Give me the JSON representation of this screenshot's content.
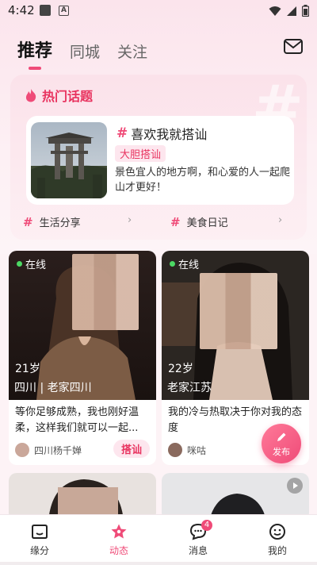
{
  "status_bar": {
    "time": "4:42",
    "icon_a": "A"
  },
  "tabs": [
    {
      "label": "推荐",
      "active": true
    },
    {
      "label": "同城",
      "active": false
    },
    {
      "label": "关注",
      "active": false
    }
  ],
  "hot_topics": {
    "title": "热门话题",
    "featured": {
      "hash": "#",
      "title": "喜欢我就搭讪",
      "tag": "大胆搭讪",
      "description": "景色宜人的地方啊，和心爱的人一起爬山才更好！"
    },
    "sub_topics": [
      {
        "hash": "#",
        "label": "生活分享"
      },
      {
        "hash": "#",
        "label": "美食日记"
      }
    ],
    "chevron": "›"
  },
  "feed": [
    {
      "online": "在线",
      "age": "21岁",
      "location": "四川 | 老家四川",
      "text": "等你足够成熟，我也刚好温柔，这样我们就可以一起...",
      "user": "四川杨千婵",
      "action": "搭讪"
    },
    {
      "online": "在线",
      "age": "22岁",
      "location": "老家江苏",
      "text": "我的冷与热取决于你对我的态度",
      "user": "咪咕"
    }
  ],
  "fab": {
    "label": "发布"
  },
  "bottom_nav": [
    {
      "label": "缘分",
      "icon": "smile-chat-icon",
      "active": false
    },
    {
      "label": "动态",
      "icon": "star-icon",
      "active": true
    },
    {
      "label": "消息",
      "icon": "message-bubble-icon",
      "active": false,
      "badge": "4"
    },
    {
      "label": "我的",
      "icon": "profile-face-icon",
      "active": false
    }
  ],
  "colors": {
    "accent": "#ef4b78",
    "accent_light": "#fde6ee",
    "online": "#4cd964"
  }
}
